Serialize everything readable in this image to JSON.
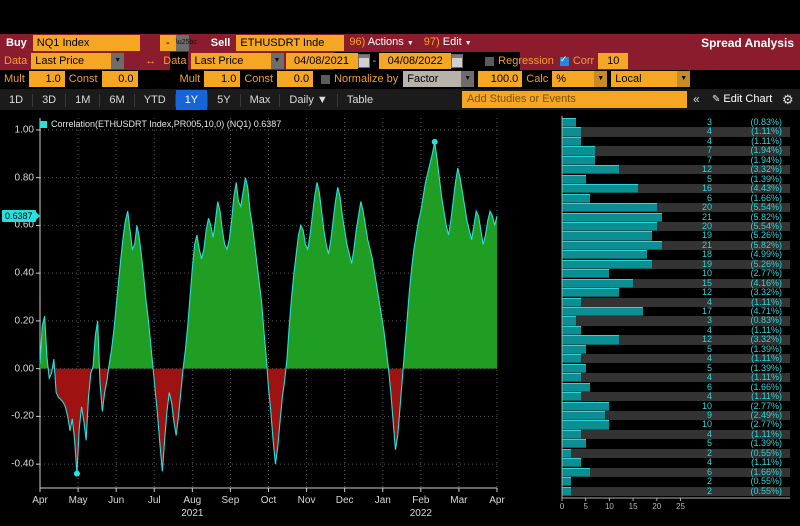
{
  "window": {
    "title": "Spread Analysis"
  },
  "toolbar": {
    "buy_label": "Buy",
    "buy_ticker": "NQ1 Index",
    "buy_minus": "-",
    "sell_label": "Sell",
    "sell_ticker": "ETHUSDRT Inde",
    "actions": {
      "num": "96)",
      "label": "Actions"
    },
    "edit": {
      "num": "97)",
      "label": "Edit"
    },
    "data_label_left": "Data",
    "data_value_left": "Last Price",
    "data_label_right": "Data",
    "data_value_right": "Last Price",
    "date_from": "04/08/2021",
    "date_dash": "-",
    "date_to": "04/08/2022",
    "regression_label": "Regression",
    "regression_checked": false,
    "corr_label": "Corr",
    "corr_value": "10",
    "mult_label_left": "Mult",
    "mult_value_left": "1.0",
    "const_label_left": "Const",
    "const_value_left": "0.0",
    "mult_label_right": "Mult",
    "mult_value_right": "1.0",
    "const_label_right": "Const",
    "const_value_right": "0.0",
    "normalize_label": "Normalize by",
    "normalize_checked": false,
    "normalize_mode": "Factor",
    "normalize_value": "100.0",
    "calc_label": "Calc",
    "calc_value": "%",
    "locale_value": "Local",
    "swap_icon": "↔"
  },
  "tabs": {
    "items": [
      {
        "label": "1D",
        "active": false
      },
      {
        "label": "3D",
        "active": false
      },
      {
        "label": "1M",
        "active": false
      },
      {
        "label": "6M",
        "active": false
      },
      {
        "label": "YTD",
        "active": false
      },
      {
        "label": "1Y",
        "active": true
      },
      {
        "label": "5Y",
        "active": false
      },
      {
        "label": "Max",
        "active": false
      },
      {
        "label": "Daily ▼",
        "active": false
      },
      {
        "label": "Table",
        "active": false
      }
    ],
    "add_studies_placeholder": "Add Studies or Events",
    "collapse_icon": "«",
    "edit_chart_label": "Edit Chart",
    "pencil_icon": "✎",
    "gear_icon": "⚙"
  },
  "chart_data": {
    "type": "area",
    "title": "",
    "legend": "Correlation(ETHUSDRT Index,PR005,10,0)  (NQ1)  0.6387",
    "legend_series_name": "Correlation(ETHUSDRT Index,PR005,10,0)",
    "legend_vs": "(NQ1)",
    "legend_last_value": "0.6387",
    "current_value_tag": "0.6387",
    "positive_color": "#1f9e23",
    "negative_color": "#9e1212",
    "line_color": "#27e0e0",
    "ylabel": "",
    "xlabel": "",
    "ylim": [
      -0.5,
      1.05
    ],
    "yticks": [
      1.0,
      0.8,
      0.6,
      0.4,
      0.2,
      0.0,
      -0.2,
      -0.4
    ],
    "ytick_labels": [
      "1.00",
      "0.80",
      "0.60",
      "0.40",
      "0.20",
      "0.00",
      "-0.20",
      "-0.40"
    ],
    "grid": true,
    "xtick_labels": [
      "Apr",
      "May",
      "Jun",
      "Jul",
      "Aug",
      "Sep",
      "Oct",
      "Nov",
      "Dec",
      "Jan",
      "Feb",
      "Mar",
      "Apr"
    ],
    "year_labels": [
      {
        "text": "2021",
        "at": "Aug"
      },
      {
        "text": "2022",
        "at": "Feb"
      }
    ],
    "values": [
      0.02,
      0.18,
      0.22,
      0.05,
      -0.04,
      -0.02,
      0.04,
      -0.1,
      -0.12,
      -0.13,
      -0.14,
      -0.16,
      -0.2,
      -0.26,
      -0.21,
      -0.3,
      -0.44,
      -0.25,
      -0.16,
      -0.22,
      -0.3,
      -0.12,
      -0.02,
      0.01,
      0.14,
      0.2,
      -0.06,
      -0.18,
      -0.1,
      -0.05,
      0.02,
      0.08,
      0.16,
      0.26,
      0.36,
      0.46,
      0.55,
      0.62,
      0.66,
      0.58,
      0.5,
      0.52,
      0.6,
      0.55,
      0.47,
      0.38,
      0.28,
      0.2,
      0.1,
      0.0,
      -0.1,
      -0.2,
      -0.32,
      -0.43,
      -0.3,
      -0.18,
      -0.1,
      -0.14,
      -0.22,
      -0.28,
      -0.2,
      -0.1,
      0.0,
      0.08,
      0.18,
      0.3,
      0.42,
      0.52,
      0.56,
      0.5,
      0.46,
      0.5,
      0.58,
      0.63,
      0.6,
      0.55,
      0.62,
      0.7,
      0.66,
      0.58,
      0.52,
      0.5,
      0.54,
      0.62,
      0.72,
      0.78,
      0.7,
      0.68,
      0.74,
      0.8,
      0.76,
      0.66,
      0.6,
      0.52,
      0.44,
      0.36,
      0.28,
      0.16,
      0.05,
      -0.08,
      -0.18,
      -0.3,
      -0.4,
      -0.33,
      -0.22,
      -0.12,
      -0.05,
      0.04,
      0.18,
      0.3,
      0.4,
      0.48,
      0.56,
      0.6,
      0.58,
      0.52,
      0.5,
      0.56,
      0.64,
      0.72,
      0.78,
      0.74,
      0.66,
      0.58,
      0.52,
      0.48,
      0.54,
      0.62,
      0.7,
      0.76,
      0.72,
      0.64,
      0.58,
      0.52,
      0.48,
      0.44,
      0.5,
      0.58,
      0.64,
      0.7,
      0.66,
      0.6,
      0.54,
      0.5,
      0.46,
      0.4,
      0.34,
      0.28,
      0.22,
      0.16,
      0.08,
      0.0,
      -0.1,
      -0.22,
      -0.34,
      -0.28,
      -0.16,
      -0.04,
      0.08,
      0.2,
      0.32,
      0.42,
      0.5,
      0.56,
      0.62,
      0.66,
      0.72,
      0.78,
      0.82,
      0.86,
      0.9,
      0.95,
      0.88,
      0.8,
      0.72,
      0.66,
      0.6,
      0.56,
      0.62,
      0.7,
      0.78,
      0.84,
      0.8,
      0.74,
      0.68,
      0.62,
      0.58,
      0.54,
      0.6,
      0.66,
      0.64,
      0.58,
      0.52,
      0.56,
      0.62,
      0.66,
      0.64,
      0.6,
      0.6387
    ]
  },
  "histogram": {
    "type": "bar",
    "orientation": "horizontal",
    "color": "#0d8e92",
    "xticks": [
      0,
      5,
      10,
      15,
      20,
      25
    ],
    "xtick_labels": [
      "0",
      "5",
      "10",
      "15",
      "20",
      "25"
    ],
    "xmax": 27,
    "bins": [
      {
        "count": 3,
        "pct": "(0.83%)"
      },
      {
        "count": 4,
        "pct": "(1.11%)"
      },
      {
        "count": 4,
        "pct": "(1.11%)"
      },
      {
        "count": 7,
        "pct": "(1.94%)"
      },
      {
        "count": 7,
        "pct": "(1.94%)"
      },
      {
        "count": 12,
        "pct": "(3.32%)"
      },
      {
        "count": 5,
        "pct": "(1.39%)"
      },
      {
        "count": 16,
        "pct": "(4.43%)"
      },
      {
        "count": 6,
        "pct": "(1.66%)"
      },
      {
        "count": 20,
        "pct": "(5.54%)"
      },
      {
        "count": 21,
        "pct": "(5.82%)"
      },
      {
        "count": 20,
        "pct": "(5.54%)"
      },
      {
        "count": 19,
        "pct": "(5.26%)"
      },
      {
        "count": 21,
        "pct": "(5.82%)"
      },
      {
        "count": 18,
        "pct": "(4.99%)"
      },
      {
        "count": 19,
        "pct": "(5.26%)"
      },
      {
        "count": 10,
        "pct": "(2.77%)"
      },
      {
        "count": 15,
        "pct": "(4.16%)"
      },
      {
        "count": 12,
        "pct": "(3.32%)"
      },
      {
        "count": 4,
        "pct": "(1.11%)"
      },
      {
        "count": 17,
        "pct": "(4.71%)"
      },
      {
        "count": 3,
        "pct": "(0.83%)"
      },
      {
        "count": 4,
        "pct": "(1.11%)"
      },
      {
        "count": 12,
        "pct": "(3.32%)"
      },
      {
        "count": 5,
        "pct": "(1.39%)"
      },
      {
        "count": 4,
        "pct": "(1.11%)"
      },
      {
        "count": 5,
        "pct": "(1.39%)"
      },
      {
        "count": 4,
        "pct": "(1.11%)"
      },
      {
        "count": 6,
        "pct": "(1.66%)"
      },
      {
        "count": 4,
        "pct": "(1.11%)"
      },
      {
        "count": 10,
        "pct": "(2.77%)"
      },
      {
        "count": 9,
        "pct": "(2.49%)"
      },
      {
        "count": 10,
        "pct": "(2.77%)"
      },
      {
        "count": 4,
        "pct": "(1.11%)"
      },
      {
        "count": 5,
        "pct": "(1.39%)"
      },
      {
        "count": 2,
        "pct": "(0.55%)"
      },
      {
        "count": 4,
        "pct": "(1.11%)"
      },
      {
        "count": 6,
        "pct": "(1.66%)"
      },
      {
        "count": 2,
        "pct": "(0.55%)"
      },
      {
        "count": 2,
        "pct": "(0.55%)"
      }
    ]
  }
}
